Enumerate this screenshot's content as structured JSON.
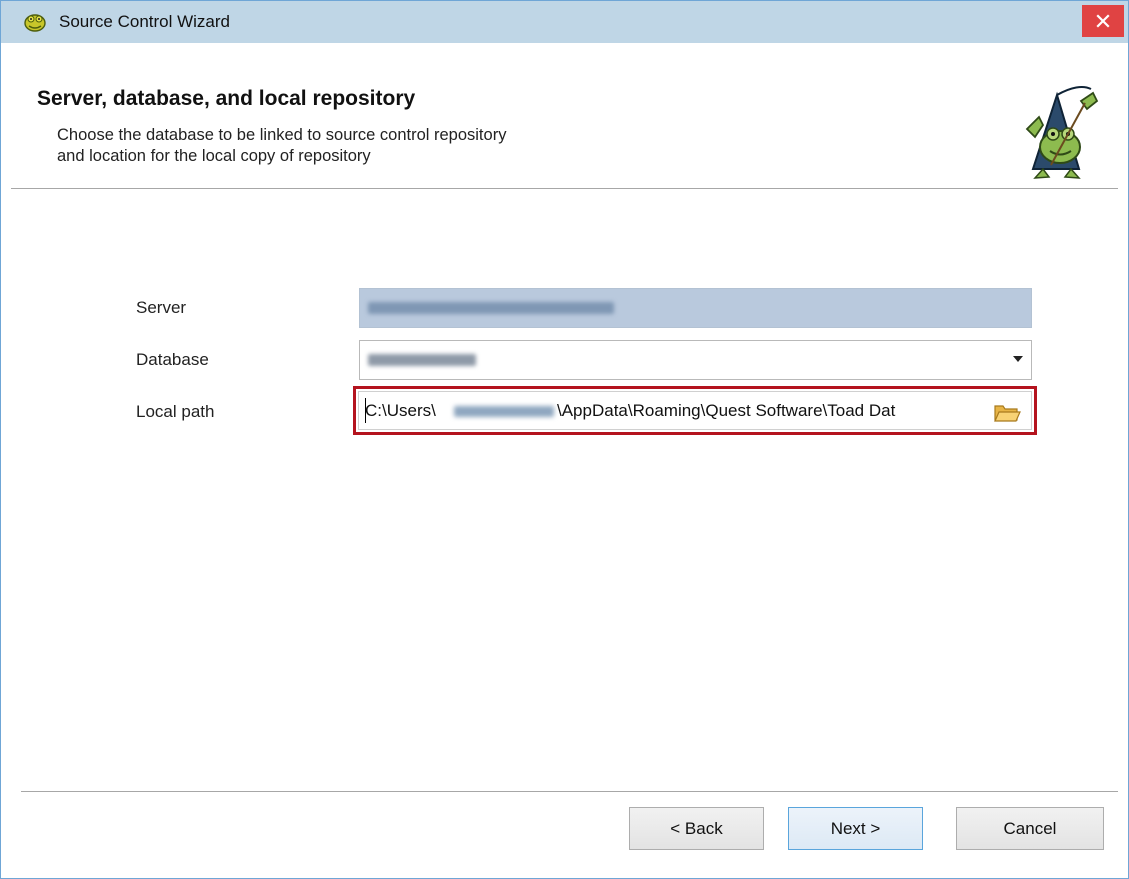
{
  "window": {
    "title": "Source Control Wizard",
    "close_label": "×"
  },
  "header": {
    "title": "Server, database, and local repository",
    "description_line1": "Choose the database to be linked to source control repository",
    "description_line2": "and location for the local copy of repository"
  },
  "form": {
    "server_label": "Server",
    "database_label": "Database",
    "local_path_label": "Local path",
    "local_path_prefix": "C:\\Users\\",
    "local_path_suffix": "\\AppData\\Roaming\\Quest Software\\Toad Dat"
  },
  "buttons": {
    "back": "< Back",
    "next": "Next >",
    "cancel": "Cancel"
  },
  "colors": {
    "titlebar": "#bfd6e6",
    "close": "#e04343",
    "highlight": "#b4131e",
    "primary_border": "#5aa5dc"
  }
}
